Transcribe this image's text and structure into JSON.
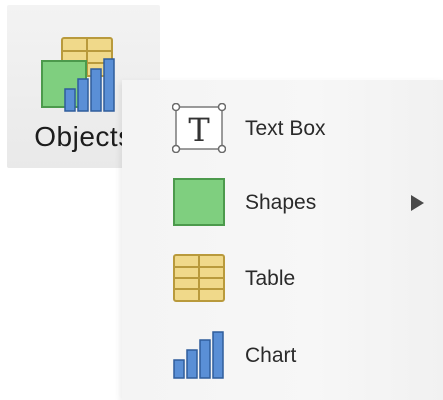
{
  "toolbar": {
    "objects_button": {
      "label": "Objects",
      "icon": "objects-icon"
    }
  },
  "menu": {
    "items": [
      {
        "label": "Text Box",
        "icon": "text-box-icon",
        "has_submenu": false
      },
      {
        "label": "Shapes",
        "icon": "shapes-icon",
        "has_submenu": true
      },
      {
        "label": "Table",
        "icon": "table-icon",
        "has_submenu": false
      },
      {
        "label": "Chart",
        "icon": "chart-icon",
        "has_submenu": false
      }
    ]
  },
  "colors": {
    "shape_green": "#7fcf7f",
    "table_yellow": "#f0d98a",
    "chart_blue": "#5a8fd6",
    "menu_background": "#f5f5f5"
  }
}
